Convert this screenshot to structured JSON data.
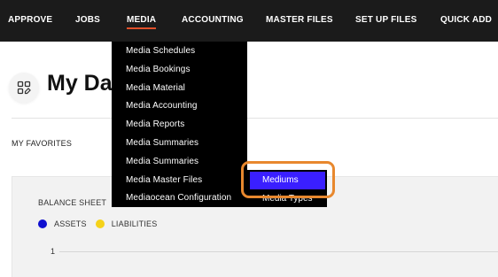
{
  "nav": {
    "items": [
      {
        "label": "APPROVE"
      },
      {
        "label": "JOBS"
      },
      {
        "label": "MEDIA"
      },
      {
        "label": "ACCOUNTING"
      },
      {
        "label": "MASTER FILES"
      },
      {
        "label": "SET UP FILES"
      },
      {
        "label": "QUICK ADD"
      }
    ],
    "active": "MEDIA",
    "active_underline_color": "#e0502a"
  },
  "page": {
    "title": "My Da",
    "icon": "dashboard-edit-icon",
    "favorites_label": "MY FAVORITES"
  },
  "widget": {
    "title": "BALANCE SHEET",
    "legend": [
      {
        "label": "ASSETS",
        "color": "#1010d0"
      },
      {
        "label": "LIABILITIES",
        "color": "#f5d21a"
      }
    ],
    "y_tick": "1"
  },
  "media_menu": {
    "items": [
      {
        "label": "Media Schedules"
      },
      {
        "label": "Media Bookings"
      },
      {
        "label": "Media Material"
      },
      {
        "label": "Media Accounting"
      },
      {
        "label": "Media Reports"
      },
      {
        "label": "Media Summaries"
      },
      {
        "label": "Media Summaries"
      },
      {
        "label": "Media Master Files"
      },
      {
        "label": "Mediaocean Configuration"
      }
    ],
    "submenu": {
      "items": [
        {
          "label": "Mediums",
          "highlighted": true,
          "color": "#3a1fff"
        },
        {
          "label": "Media Types"
        }
      ]
    },
    "callout_color": "#e8882e"
  }
}
